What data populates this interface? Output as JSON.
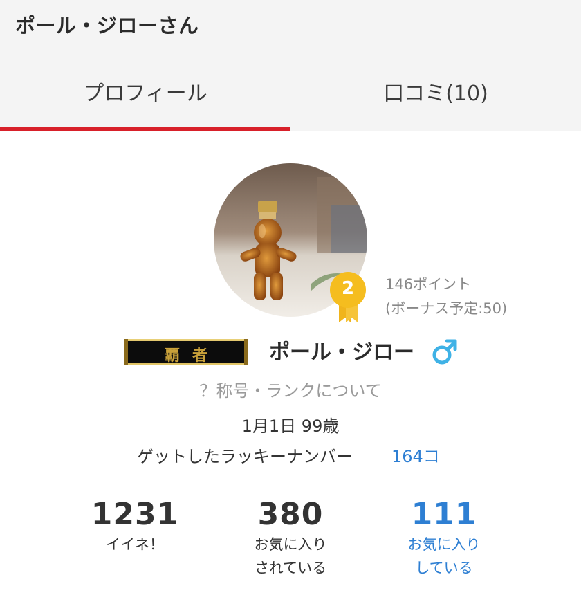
{
  "header": {
    "title": "ポール・ジローさん"
  },
  "tabs": [
    {
      "label": "プロフィール",
      "active": true
    },
    {
      "label": "口コミ(10)",
      "active": false
    }
  ],
  "profile": {
    "rank": "2",
    "points": "146ポイント",
    "bonus": "(ボーナス予定:50)",
    "title_badge": "覇者",
    "name": "ポール・ジロー",
    "gender_icon": "male-icon",
    "rank_help": "？称号・ランクについて",
    "birthday": "1月1日 99歳",
    "lucky_label": "ゲットしたラッキーナンバー",
    "lucky_count": "164コ"
  },
  "stats": [
    {
      "value": "1231",
      "label_line1": "イイネ！",
      "label_line2": ""
    },
    {
      "value": "380",
      "label_line1": "お気に入り",
      "label_line2": "されている"
    },
    {
      "value": "111",
      "label_line1": "お気に入り",
      "label_line2": "している"
    }
  ],
  "colors": {
    "accent_red": "#d8202a",
    "link_blue": "#2e7fd3",
    "badge_gold": "#f5bd1f",
    "gender_blue": "#3fb2e6"
  }
}
